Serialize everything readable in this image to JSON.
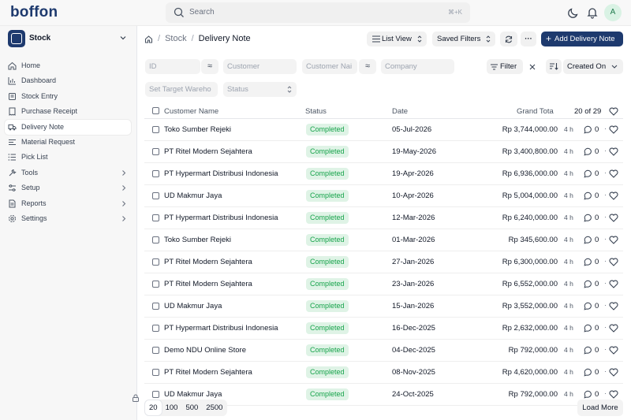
{
  "app": {
    "logo": "boffon"
  },
  "search": {
    "placeholder": "Search",
    "shortcut": "⌘+K"
  },
  "user": {
    "initial": "A"
  },
  "workspace": {
    "name": "Stock"
  },
  "sidebar": {
    "items": [
      {
        "label": "Home",
        "icon": "home-icon"
      },
      {
        "label": "Dashboard",
        "icon": "bar-chart-icon"
      },
      {
        "label": "Stock Entry",
        "icon": "stock-entry-icon"
      },
      {
        "label": "Purchase Receipt",
        "icon": "receipt-icon"
      },
      {
        "label": "Delivery Note",
        "icon": "truck-icon",
        "active": true
      },
      {
        "label": "Material Request",
        "icon": "request-icon"
      },
      {
        "label": "Pick List",
        "icon": "list-icon"
      },
      {
        "label": "Tools",
        "icon": "tools-icon",
        "chevron": true
      },
      {
        "label": "Setup",
        "icon": "setup-icon",
        "chevron": true
      },
      {
        "label": "Reports",
        "icon": "reports-icon",
        "chevron": true
      },
      {
        "label": "Settings",
        "icon": "settings-icon",
        "chevron": true
      }
    ]
  },
  "breadcrumb": {
    "level1": "Stock",
    "level2": "Delivery Note"
  },
  "header": {
    "view_label": "List View",
    "saved_filters_label": "Saved Filters",
    "add_label": "Add Delivery Note"
  },
  "filters": {
    "id_placeholder": "ID",
    "customer_placeholder": "Customer",
    "customer_name_placeholder": "Customer Nai",
    "company_placeholder": "Company",
    "warehouse_placeholder": "Set Target Wareho",
    "status_placeholder": "Status",
    "filter_label": "Filter",
    "sort_label": "Created On"
  },
  "table": {
    "columns": {
      "customer_name": "Customer Name",
      "status": "Status",
      "date": "Date",
      "grand_total": "Grand Tota"
    },
    "count": "20 of 29",
    "rows": [
      {
        "customer": "Toko Sumber Rejeki",
        "status": "Completed",
        "date": "05-Jul-2026",
        "total": "Rp 3,744,000.00",
        "time": "4 h",
        "comments": "0"
      },
      {
        "customer": "PT Ritel Modern Sejahtera",
        "status": "Completed",
        "date": "19-May-2026",
        "total": "Rp 3,400,800.00",
        "time": "4 h",
        "comments": "0"
      },
      {
        "customer": "PT Hypermart Distribusi Indonesia",
        "status": "Completed",
        "date": "19-Apr-2026",
        "total": "Rp 6,936,000.00",
        "time": "4 h",
        "comments": "0"
      },
      {
        "customer": "UD Makmur Jaya",
        "status": "Completed",
        "date": "10-Apr-2026",
        "total": "Rp 5,004,000.00",
        "time": "4 h",
        "comments": "0"
      },
      {
        "customer": "PT Hypermart Distribusi Indonesia",
        "status": "Completed",
        "date": "12-Mar-2026",
        "total": "Rp 6,240,000.00",
        "time": "4 h",
        "comments": "0"
      },
      {
        "customer": "Toko Sumber Rejeki",
        "status": "Completed",
        "date": "01-Mar-2026",
        "total": "Rp 345,600.00",
        "time": "4 h",
        "comments": "0"
      },
      {
        "customer": "PT Ritel Modern Sejahtera",
        "status": "Completed",
        "date": "27-Jan-2026",
        "total": "Rp 6,300,000.00",
        "time": "4 h",
        "comments": "0"
      },
      {
        "customer": "PT Ritel Modern Sejahtera",
        "status": "Completed",
        "date": "23-Jan-2026",
        "total": "Rp 6,552,000.00",
        "time": "4 h",
        "comments": "0"
      },
      {
        "customer": "UD Makmur Jaya",
        "status": "Completed",
        "date": "15-Jan-2026",
        "total": "Rp 3,552,000.00",
        "time": "4 h",
        "comments": "0"
      },
      {
        "customer": "PT Hypermart Distribusi Indonesia",
        "status": "Completed",
        "date": "16-Dec-2025",
        "total": "Rp 2,632,000.00",
        "time": "4 h",
        "comments": "0"
      },
      {
        "customer": "Demo NDU Online Store",
        "status": "Completed",
        "date": "04-Dec-2025",
        "total": "Rp 792,000.00",
        "time": "4 h",
        "comments": "0"
      },
      {
        "customer": "PT Ritel Modern Sejahtera",
        "status": "Completed",
        "date": "08-Nov-2025",
        "total": "Rp 4,620,000.00",
        "time": "4 h",
        "comments": "0"
      },
      {
        "customer": "UD Makmur Jaya",
        "status": "Completed",
        "date": "24-Oct-2025",
        "total": "Rp 792,000.00",
        "time": "4 h",
        "comments": "0"
      }
    ]
  },
  "pager": {
    "sizes": [
      "20",
      "100",
      "500",
      "2500"
    ],
    "selected": "20",
    "load_more": "Load More"
  },
  "colors": {
    "primary": "#1e3a6e",
    "status_bg": "#dff3e6",
    "status_text": "#16a34a"
  }
}
